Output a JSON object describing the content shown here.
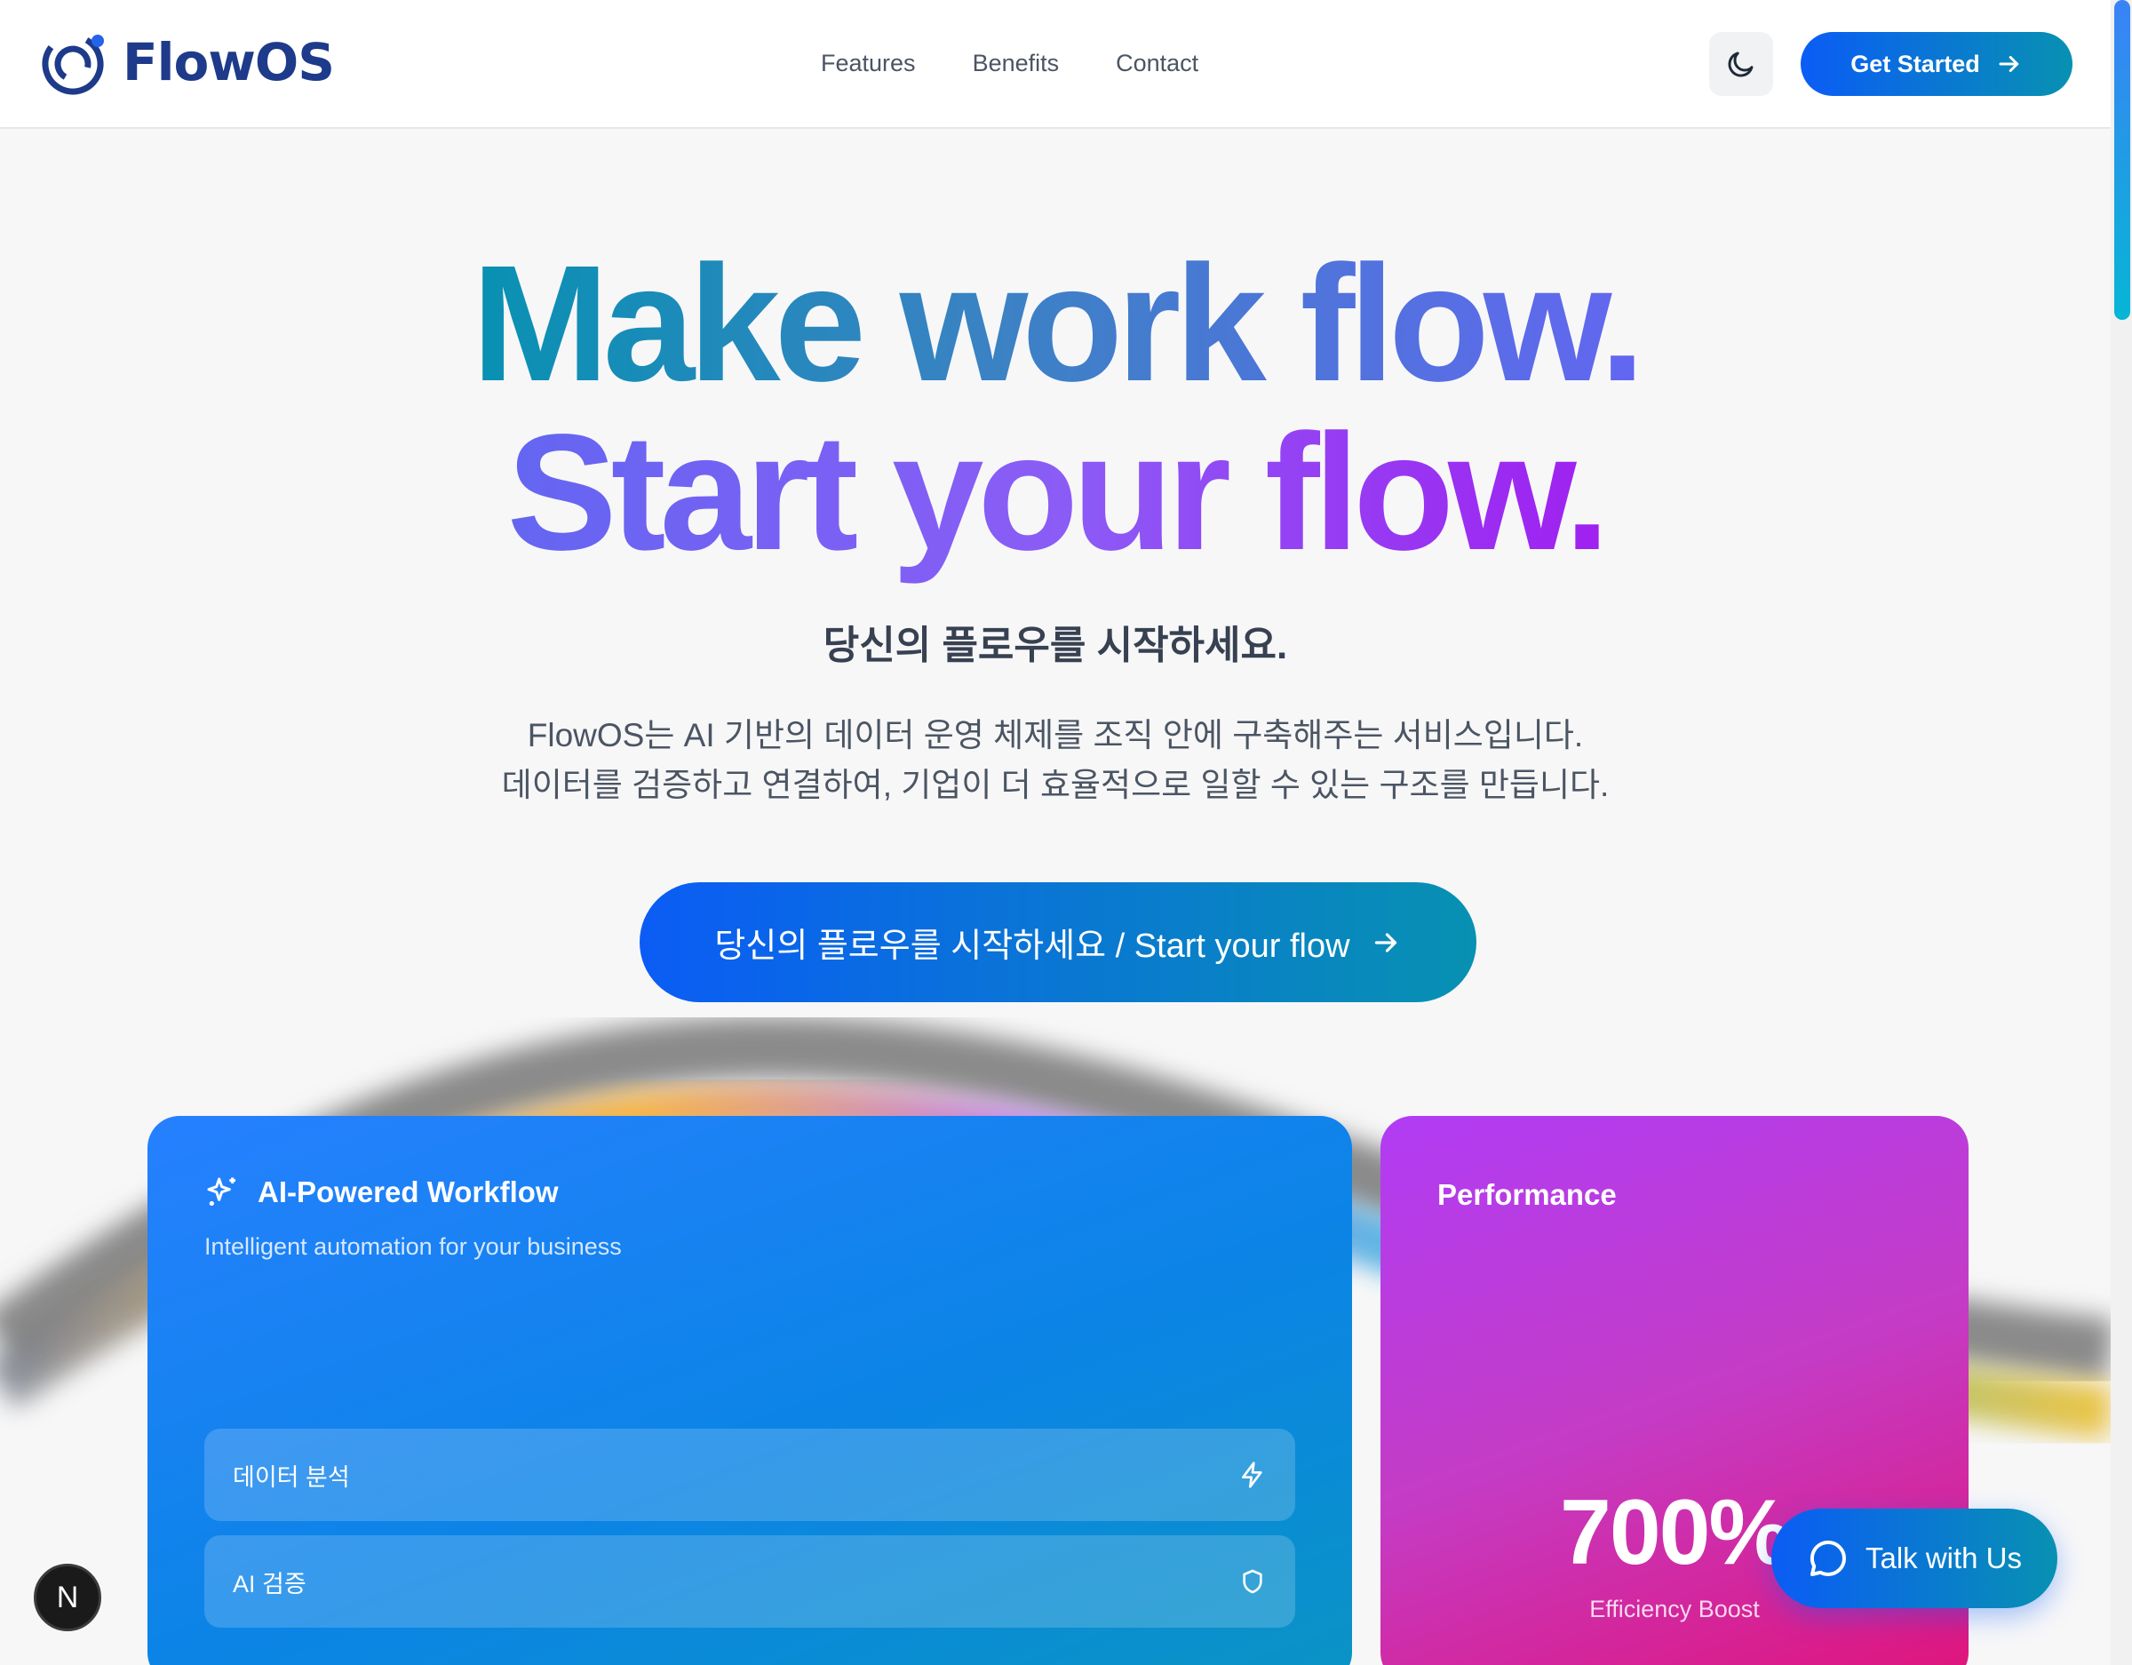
{
  "brand": {
    "name": "FlowOS",
    "color": "#1e3a8a",
    "accent": "#0b5cf5"
  },
  "nav": {
    "items": [
      {
        "label": "Features"
      },
      {
        "label": "Benefits"
      },
      {
        "label": "Contact"
      }
    ],
    "theme_icon": "moon-icon",
    "cta_label": "Get Started"
  },
  "hero": {
    "line1": "Make work flow.",
    "line2": "Start your flow.",
    "subtitle": "당신의 플로우를 시작하세요.",
    "description_1": "FlowOS는 AI 기반의 데이터 운영 체제를 조직 안에 구축해주는 서비스입니다.",
    "description_2": "데이터를 검증하고 연결하여, 기업이 더 효율적으로 일할 수 있는 구조를 만듭니다.",
    "cta_label": "당신의 플로우를 시작하세요 / Start your flow"
  },
  "workflow_card": {
    "title": "AI-Powered Workflow",
    "subtitle": "Intelligent automation for your business",
    "icon": "sparkles-icon",
    "items": [
      {
        "label": "데이터 분석",
        "icon": "lightning-icon"
      },
      {
        "label": "AI 검증",
        "icon": "shield-icon"
      }
    ]
  },
  "performance_card": {
    "title": "Performance",
    "value": "700%",
    "label": "Efficiency Boost"
  },
  "chat": {
    "label": "Talk with Us",
    "icon": "chat-bubble-icon"
  },
  "dev_badge": {
    "label": "N"
  }
}
